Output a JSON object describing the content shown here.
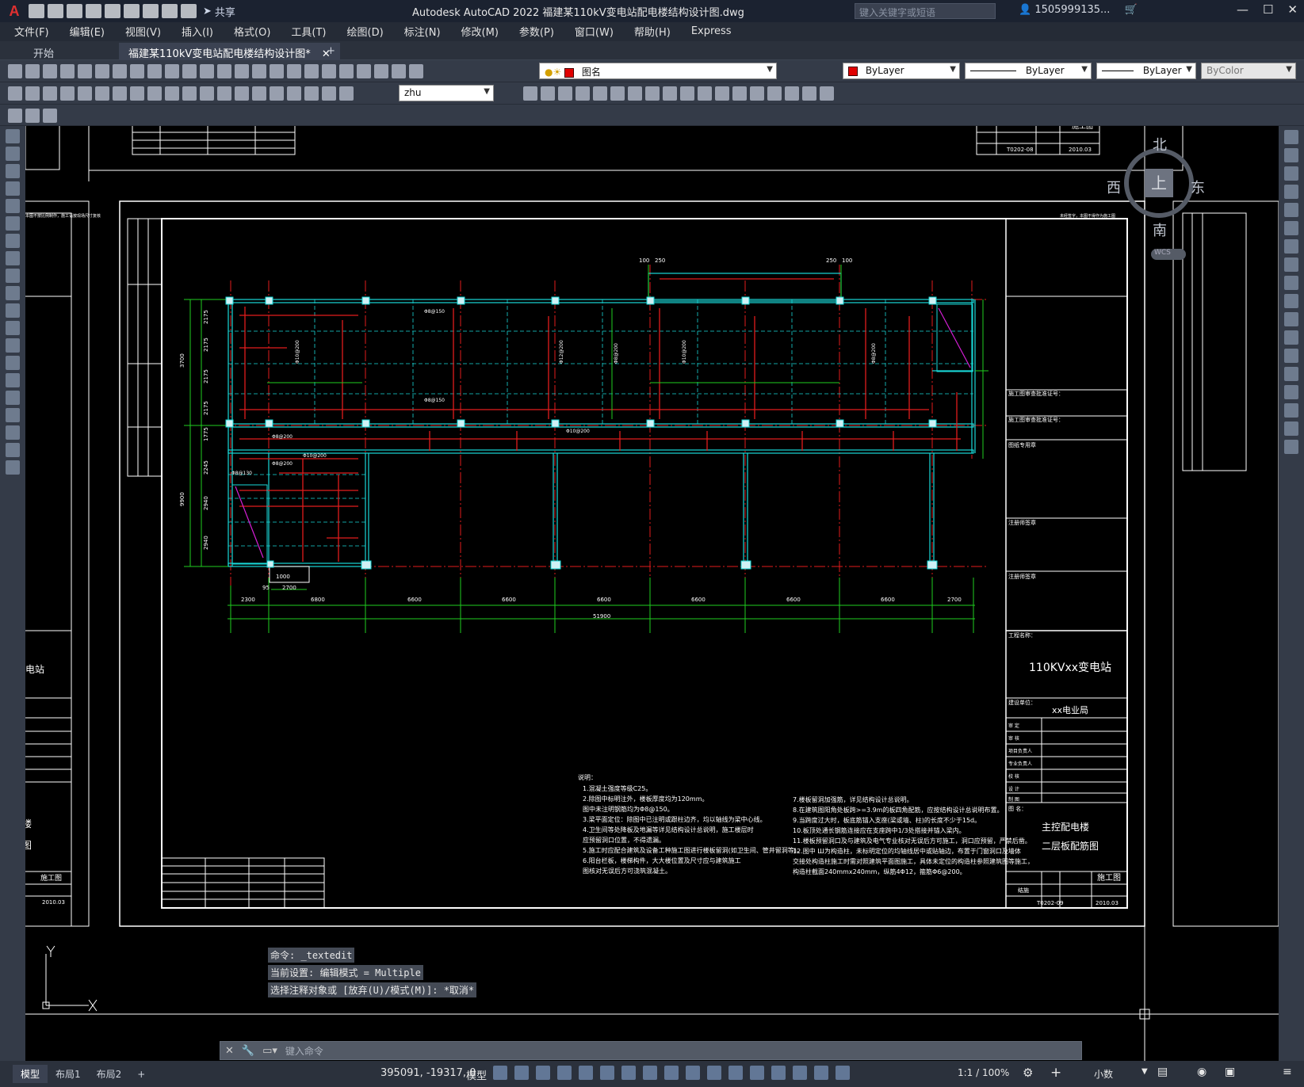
{
  "app": {
    "logo": "A",
    "share_label": "共享",
    "title": "Autodesk AutoCAD 2022    福建某110kV变电站配电楼结构设计图.dwg",
    "search_placeholder": "键入关键字或短语",
    "user": "1505999135...",
    "help": "?"
  },
  "menu": [
    "文件(F)",
    "编辑(E)",
    "视图(V)",
    "插入(I)",
    "格式(O)",
    "工具(T)",
    "绘图(D)",
    "标注(N)",
    "修改(M)",
    "参数(P)",
    "窗口(W)",
    "帮助(H)",
    "Express"
  ],
  "tabs": {
    "start": "开始",
    "doc": "福建某110kV变电站配电楼结构设计图*",
    "add": "+"
  },
  "toolbar": {
    "layer": "图名",
    "color": "ByLayer",
    "linetype": "ByLayer",
    "lineweight": "ByLayer",
    "plotstyle": "ByColor",
    "dimstyle": "zhu"
  },
  "viewcube": {
    "north": "北",
    "south": "南",
    "east": "东",
    "west": "西",
    "top": "上",
    "wcs": "WCS"
  },
  "drawing": {
    "project_name_label": "工程名称：",
    "project_name": "110KVxx变电站",
    "client_label": "建设单位：",
    "client": "xx电业局",
    "drawing_title_label": "图    名：",
    "drawing_title_1": "主控配电楼",
    "drawing_title_2": "二层板配筋图",
    "stage": "施工图",
    "drawing_no": "T0202-09",
    "date": "2010.03",
    "discipline": "结施",
    "top_drawing_no": "T0202-08",
    "review_1": "施工图审查批准证号：",
    "review_2": "施工图审查批准证号：",
    "approval": "图纸专用章",
    "seal_1": "注册师签章",
    "seal_2": "注册师签章",
    "sign_rows": [
      "审  定",
      "审  核",
      "项目负责人",
      "专业负责人",
      "校  核",
      "设  计",
      "制  图"
    ],
    "dims": [
      "2300",
      "6800",
      "6600",
      "6600",
      "6600",
      "6600",
      "6600",
      "6600",
      "2700"
    ],
    "total": "51900",
    "dim_top": [
      "100",
      "250",
      "250",
      "100"
    ],
    "dim_left": [
      "2175",
      "2175",
      "2175",
      "2175",
      "1775",
      "2245",
      "2940",
      "2940"
    ],
    "left_total_1": "3700",
    "left_total_2": "9900",
    "dim_700": "2700",
    "dim_95": "95",
    "dim_1000": "1000",
    "rebar": [
      "Φ8@150",
      "Φ8@150",
      "Φ10@200",
      "Φ8@200",
      "Φ10@200",
      "Φ8@200",
      "Φ8@130",
      "Φ10@200",
      "Φ12@200",
      "Φ8@200",
      "Φ10@200",
      "Φ8@200"
    ],
    "notes_head": "说明：",
    "notes_left": [
      "1.混凝土强度等级C25。",
      "2.除图中标明注外，楼板厚度均为120mm。",
      "  图中未注明钢筋均为Φ8@150。",
      "3.梁平面定位：除图中已注明或跟柱边齐，均以轴线为梁中心线。",
      "4.卫生间等处降板及地漏等详见结构设计总说明，施工楼层时",
      "  应预留洞口位置，不得遗漏。",
      "5.施工时应配合建筑及设备工种施工图进行楼板留洞(如卫生间、管井留洞等)。",
      "6.阳台栏板，楼梯构件，大大楼位置及尺寸应与建筑施工",
      "  图核对无误后方可浇筑混凝土。"
    ],
    "notes_right": [
      "7.楼板留洞加强筋，详见结构设计总说明。",
      "8.在建筑图阳角处板跨>=3.9m的板四角配筋，应按结构设计总说明布置。",
      "9.当跨度过大时，板底筋锚入支座(梁或墙、柱)的长度不少于15d。",
      "10.板顶处通长钢筋连接应在支座跨中1/3处搭接并锚入梁内。",
      "11.楼板预留洞口及与建筑及电气专业核对无误后方可施工，洞口应预留，严禁后凿。",
      "12.图中 Ш为构造柱，未标明定位的均轴线居中或贴轴边，布置于门窗洞口及墙体",
      "   交接处构造柱施工时需对照建筑平面图施工，具体未定位的构造柱参照建筑图等施工，",
      "   构造柱截面240mmx240mm，纵筋4Φ12，箍筋Φ6@200。"
    ],
    "side_left_1": "电站",
    "side_left_2": "楼",
    "side_left_3": "图",
    "side_left_stage": "施工图",
    "side_left_date": "2010.03",
    "note_top_left": "本图不按比例制作，施工请按现场尺寸复核",
    "note_top_right": "未经签字，本图不得作为施工图"
  },
  "command": {
    "history": [
      "命令:  _textedit",
      "当前设置: 编辑模式 = Multiple",
      "选择注释对象或 [放弃(U)/模式(M)]: *取消*"
    ],
    "placeholder": "键入命令"
  },
  "status": {
    "tabs": [
      "模型",
      "布局1",
      "布局2"
    ],
    "add": "+",
    "coords": "395091, -19317, 0",
    "space": "模型",
    "scale": "1:1 / 100%",
    "units": "小数"
  },
  "colors": {
    "beam_red": "#e21d1d",
    "grid_green": "#1fce1f",
    "cyan": "#19d8d8",
    "magenta": "#d61fd6",
    "white": "#ffffff"
  }
}
